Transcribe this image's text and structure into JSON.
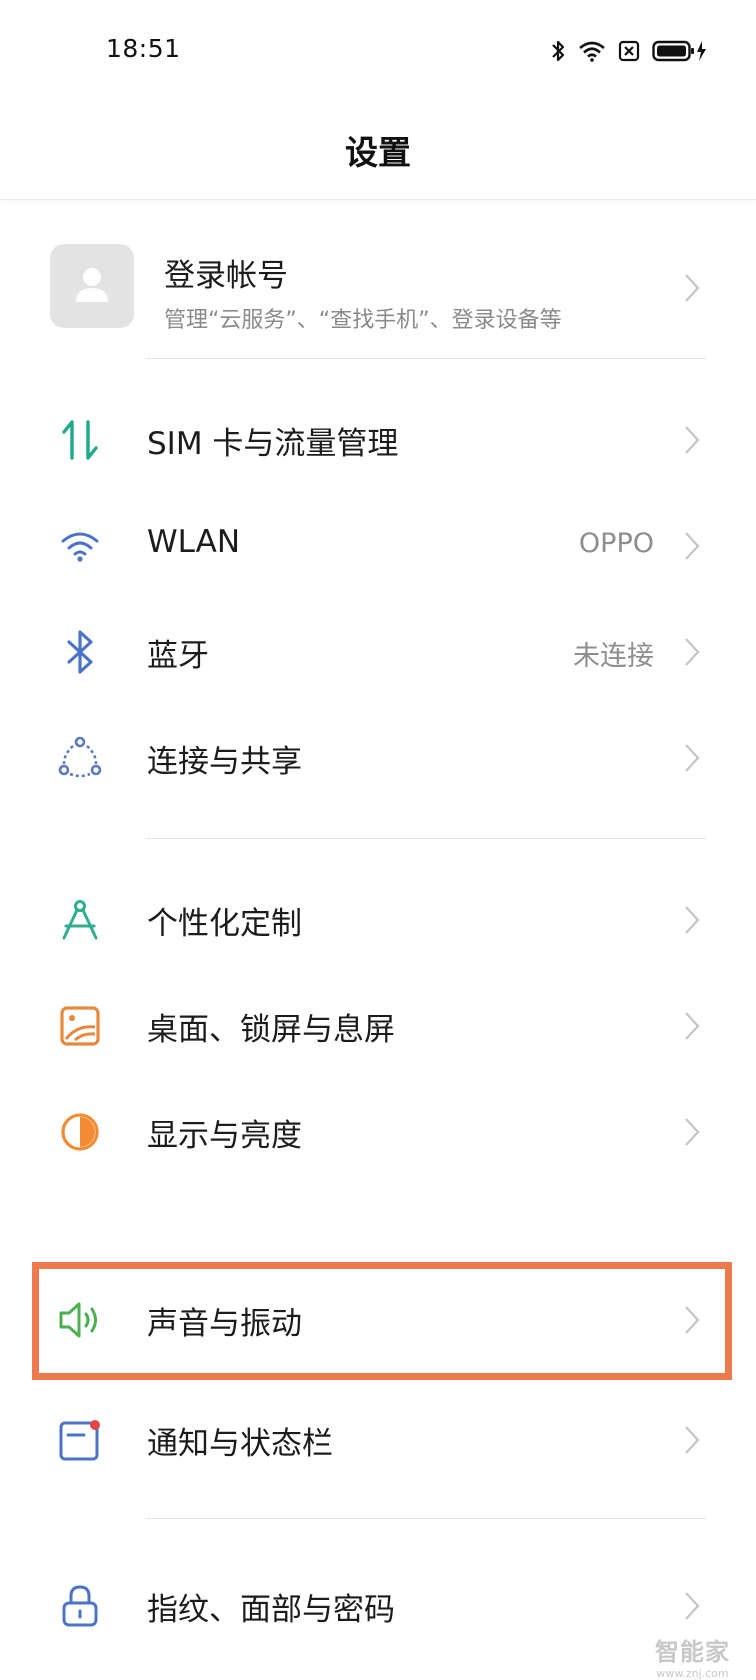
{
  "status_bar": {
    "time": "18:51",
    "icons": [
      "bluetooth-icon",
      "wifi-icon",
      "sim-off-icon",
      "battery-charging-icon"
    ]
  },
  "header": {
    "title": "设置"
  },
  "account": {
    "title": "登录帐号",
    "subtitle": "管理“云服务”、“查找手机”、登录设备等",
    "icon": "person-icon"
  },
  "rows": [
    {
      "label": "SIM 卡与流量管理",
      "value": "",
      "icon": "sim-data-icon",
      "color": "#1fa98b"
    },
    {
      "label": "WLAN",
      "value": "OPPO",
      "icon": "wifi-icon",
      "color": "#4a74c8"
    },
    {
      "label": "蓝牙",
      "value": "未连接",
      "icon": "bluetooth-icon",
      "color": "#4a74c8"
    },
    {
      "label": "连接与共享",
      "value": "",
      "icon": "connection-share-icon",
      "color": "#5a7ab8"
    },
    {
      "label": "个性化定制",
      "value": "",
      "icon": "compass-icon",
      "color": "#2fae8f"
    },
    {
      "label": "桌面、锁屏与息屏",
      "value": "",
      "icon": "wallpaper-icon",
      "color": "#e7883f"
    },
    {
      "label": "显示与亮度",
      "value": "",
      "icon": "brightness-icon",
      "color": "#f28b31"
    },
    {
      "label": "声音与振动",
      "value": "",
      "icon": "speaker-icon",
      "color": "#4caf50",
      "highlighted": true
    },
    {
      "label": "通知与状态栏",
      "value": "",
      "icon": "notification-icon",
      "color": "#4a74c8"
    },
    {
      "label": "指纹、面部与密码",
      "value": "",
      "icon": "lock-icon",
      "color": "#4a74c8"
    }
  ],
  "colors": {
    "highlight_border": "#ec7a4c",
    "divider": "#e6e6e6",
    "secondary_text": "#8a8a8a"
  },
  "watermark": {
    "main": "智能家",
    "sub": "www.znj.com"
  }
}
